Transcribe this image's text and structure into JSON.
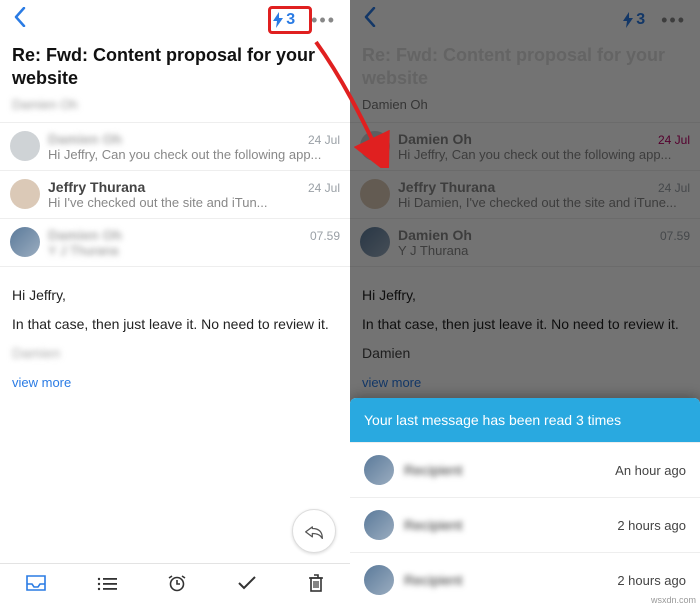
{
  "left": {
    "bolt_count": "3",
    "subject": "Re: Fwd: Content proposal for your website",
    "sender_meta": "Damien Oh",
    "items": [
      {
        "name": "Damien Oh",
        "date": "24 Jul",
        "preview": "Hi Jeffry, Can you check out the following app..."
      },
      {
        "name": "Jeffry Thurana",
        "date": "24 Jul",
        "preview": "Hi           I've checked out the site and iTun..."
      },
      {
        "name": "Damien Oh",
        "date": "07.59",
        "preview": "Y J Thurana"
      }
    ],
    "body_greeting": "Hi Jeffry,",
    "body_line": "In that case, then just leave it. No need to review it.",
    "sig": "Damien",
    "view_more": "view more"
  },
  "right": {
    "bolt_count": "3",
    "subject": "Re: Fwd: Content proposal for your website",
    "sender_meta": "Damien Oh",
    "items": [
      {
        "name": "Damien Oh",
        "date": "24 Jul",
        "preview": "Hi Jeffry, Can you check out the following app..."
      },
      {
        "name": "Jeffry Thurana",
        "date": "24 Jul",
        "preview": "Hi Damien, I've checked out the site and iTune..."
      },
      {
        "name": "Damien Oh",
        "date": "07.59",
        "preview": "Y J Thurana"
      }
    ],
    "body_greeting": "Hi Jeffry,",
    "body_line": "In that case, then just leave it. No need to review it.",
    "sig": "Damien",
    "view_more": "view more",
    "sheet_header": "Your last message has been read 3 times",
    "reads": [
      {
        "name": "Recipient",
        "time": "An hour ago"
      },
      {
        "name": "Recipient",
        "time": "2 hours ago"
      },
      {
        "name": "Recipient",
        "time": "2 hours ago"
      }
    ]
  },
  "watermark": "wsxdn.com"
}
